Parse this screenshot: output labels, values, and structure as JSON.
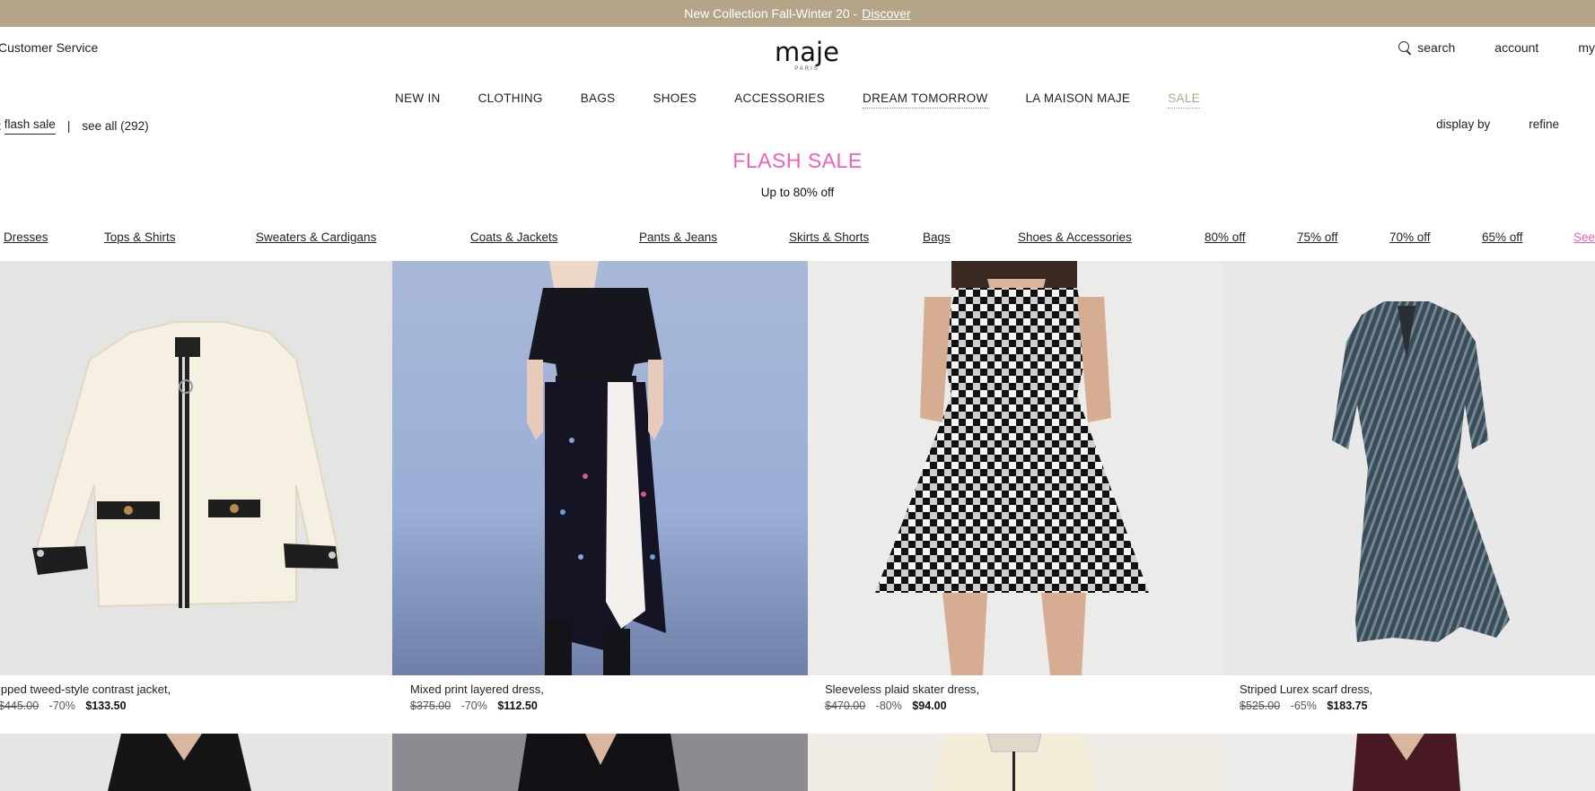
{
  "promo": {
    "text": "New Collection Fall-Winter 20 -",
    "link": "Discover"
  },
  "header": {
    "customer_service": "Customer Service",
    "logo": "maje",
    "logo_sub": "PARIS",
    "search": "search",
    "account": "account",
    "my": "my"
  },
  "nav": {
    "items": [
      "NEW IN",
      "CLOTHING",
      "BAGS",
      "SHOES",
      "ACCESSORIES",
      "DREAM TOMORROW",
      "LA MAISON MAJE",
      "SALE"
    ]
  },
  "filters": {
    "crumb_prefix": ":",
    "crumb_active": "flash sale",
    "separator": "|",
    "see_all": "see all (292)",
    "display_by": "display by",
    "refine": "refine"
  },
  "sale": {
    "title": "FLASH SALE",
    "subtitle": "Up to 80% off"
  },
  "categories": [
    "Dresses",
    "Tops & Shirts",
    "Sweaters & Cardigans",
    "Coats & Jackets",
    "Pants & Jeans",
    "Skirts & Shorts",
    "Bags",
    "Shoes & Accessories",
    "80% off",
    "75% off",
    "70% off",
    "65% off",
    "See"
  ],
  "products": [
    {
      "name": "ipped tweed-style contrast jacket,",
      "old_price": "$445.00",
      "discount": "-70%",
      "new_price": "$133.50"
    },
    {
      "name": "Mixed print layered dress,",
      "old_price": "$375.00",
      "discount": "-70%",
      "new_price": "$112.50"
    },
    {
      "name": "Sleeveless plaid skater dress,",
      "old_price": "$470.00",
      "discount": "-80%",
      "new_price": "$94.00"
    },
    {
      "name": "Striped Lurex scarf dress,",
      "old_price": "$525.00",
      "discount": "-65%",
      "new_price": "$183.75"
    }
  ],
  "colors": {
    "promo_bg": "#b4a488",
    "accent_pink": "#f060b8",
    "sale_gold": "#b4a488"
  }
}
